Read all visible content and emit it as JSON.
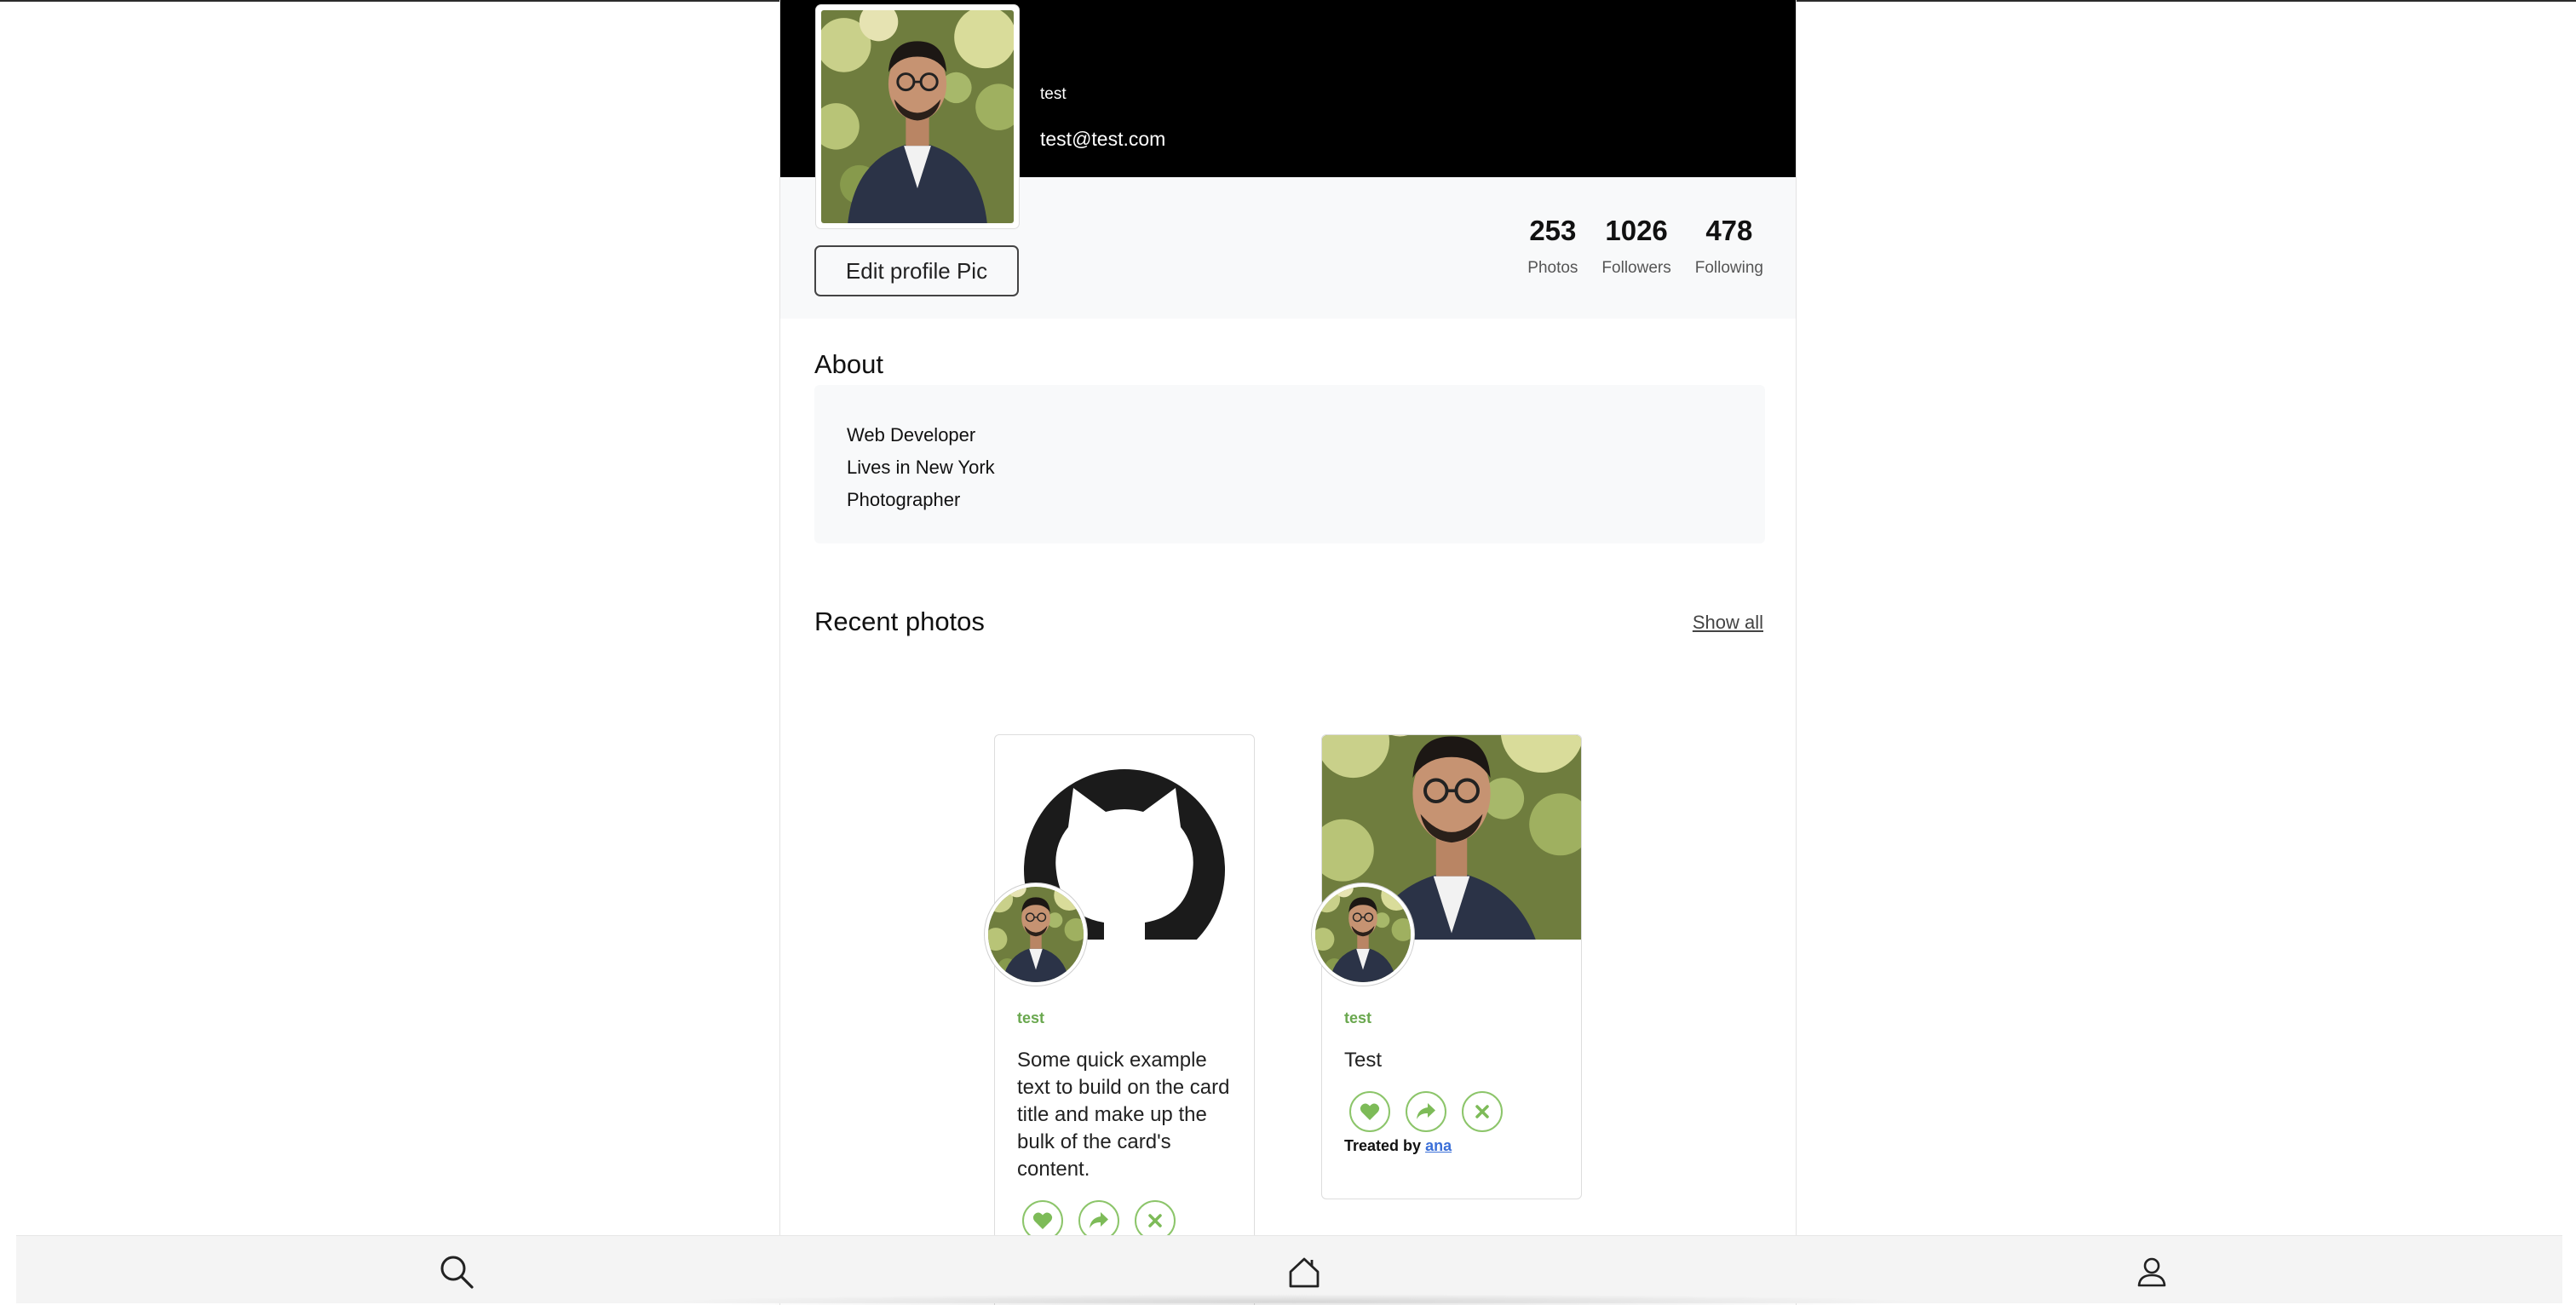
{
  "profile": {
    "name": "test",
    "email": "test@test.com",
    "edit_button": "Edit profile Pic",
    "stats": [
      {
        "value": "253",
        "label": "Photos"
      },
      {
        "value": "1026",
        "label": "Followers"
      },
      {
        "value": "478",
        "label": "Following"
      }
    ]
  },
  "about": {
    "title": "About",
    "lines": [
      "Web Developer",
      "Lives in New York",
      "Photographer"
    ]
  },
  "recent": {
    "title": "Recent photos",
    "show_all": "Show all",
    "cards": [
      {
        "image_icon": "github-logo",
        "username": "test",
        "text": "Some quick example text to build on the card title and make up the bulk of the card's content.",
        "actions": [
          "heart-icon",
          "share-icon",
          "close-icon"
        ]
      },
      {
        "image_icon": "profile-photo",
        "username": "test",
        "text": "Test",
        "actions": [
          "heart-icon",
          "share-icon",
          "close-icon"
        ],
        "treated_by_label": "Treated by",
        "treated_by_user": "ana"
      }
    ]
  },
  "bottom_nav": {
    "items": [
      "search-icon",
      "home-icon",
      "user-icon"
    ]
  },
  "colors": {
    "accent_green": "#6aa84f",
    "link_blue": "#3b6fd8",
    "cover": "#000000"
  }
}
